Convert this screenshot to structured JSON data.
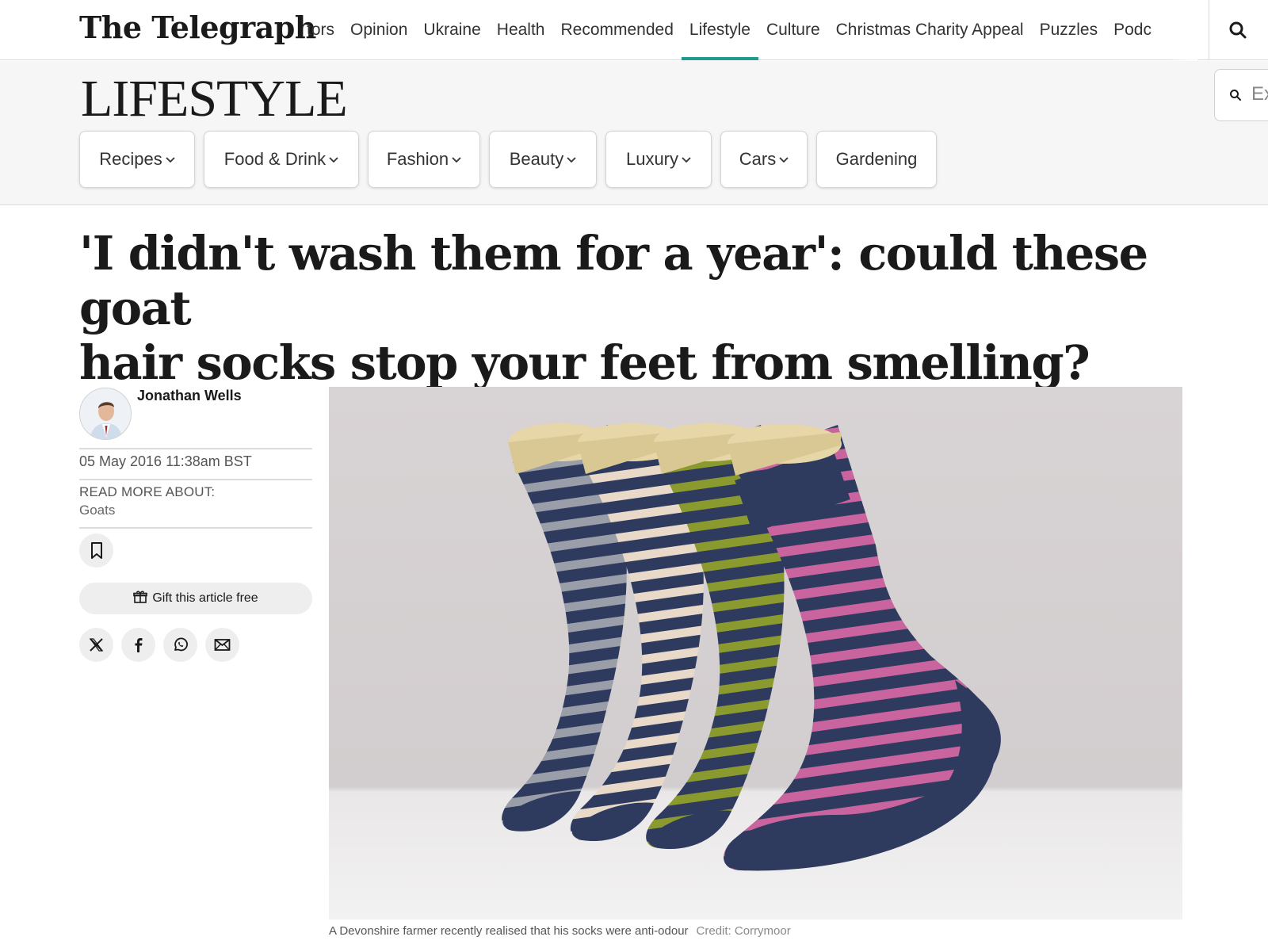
{
  "header": {
    "logo": "The Telegraph",
    "nav": [
      {
        "label": "tors",
        "active": false
      },
      {
        "label": "Opinion",
        "active": false
      },
      {
        "label": "Ukraine",
        "active": false
      },
      {
        "label": "Health",
        "active": false
      },
      {
        "label": "Recommended",
        "active": false
      },
      {
        "label": "Lifestyle",
        "active": true
      },
      {
        "label": "Culture",
        "active": false
      },
      {
        "label": "Christmas Charity Appeal",
        "active": false
      },
      {
        "label": "Puzzles",
        "active": false
      },
      {
        "label": "Podc",
        "active": false
      }
    ],
    "search_icon": "search-icon"
  },
  "section": {
    "title": "LIFESTYLE",
    "search_placeholder": "Ex",
    "pills": [
      {
        "label": "Recipes",
        "has_dropdown": true
      },
      {
        "label": "Food & Drink",
        "has_dropdown": true
      },
      {
        "label": "Fashion",
        "has_dropdown": true
      },
      {
        "label": "Beauty",
        "has_dropdown": true
      },
      {
        "label": "Luxury",
        "has_dropdown": true
      },
      {
        "label": "Cars",
        "has_dropdown": true
      },
      {
        "label": "Gardening",
        "has_dropdown": false
      }
    ]
  },
  "article": {
    "headline_line1": "'I didn't wash them for a year': could these goat",
    "headline_line2": "hair socks stop your feet from smelling?",
    "author": "Jonathan Wells",
    "date": "05 May 2016 11:38am BST",
    "read_more_label": "READ MORE ABOUT:",
    "read_more_topic": "Goats",
    "gift_label": "Gift this article free",
    "share_icons": [
      "x-icon",
      "facebook-icon",
      "whatsapp-icon",
      "email-icon"
    ],
    "image_caption": "A Devonshire farmer recently realised that his socks were anti-odour",
    "image_credit": "Credit: Corrymoor"
  },
  "colors": {
    "accent": "#1e9a8f",
    "sock_navy": "#2e3a5e",
    "sock_grey": "#9a9ea8",
    "sock_cream": "#e8d9c9",
    "sock_olive": "#8a9a2e",
    "sock_pink": "#c9649e"
  }
}
